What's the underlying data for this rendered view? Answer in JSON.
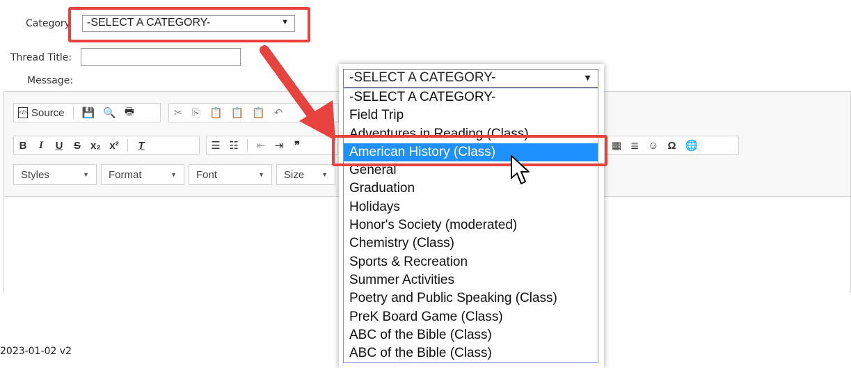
{
  "form": {
    "category_label": "Category",
    "category_value": "-SELECT A CATEGORY-",
    "thread_title_label": "Thread Title:",
    "thread_title_value": "",
    "message_label": "Message:"
  },
  "toolbar": {
    "source_label": "Source",
    "combos": [
      {
        "label": "Styles"
      },
      {
        "label": "Format"
      },
      {
        "label": "Font"
      },
      {
        "label": "Size"
      }
    ]
  },
  "dropdown": {
    "selected_value": "-SELECT A CATEGORY-",
    "options": [
      "-SELECT A CATEGORY-",
      "Field Trip",
      "Adventures in Reading (Class)",
      "American History (Class)",
      "General",
      "Graduation",
      "Holidays",
      "Honor's Society (moderated)",
      "Chemistry (Class)",
      "Sports & Recreation",
      "Summer Activities",
      "Poetry and Public Speaking (Class)",
      "PreK Board Game (Class)",
      "ABC of the Bible (Class)",
      "ABC of the Bible (Class)"
    ],
    "highlighted_option": "American History (Class)"
  },
  "footer": {
    "version_text": "2023-01-02 v2"
  },
  "colors": {
    "highlight_border": "#e8423f",
    "selected_option_bg": "#1e90ff",
    "arrow": "#e8423f"
  }
}
